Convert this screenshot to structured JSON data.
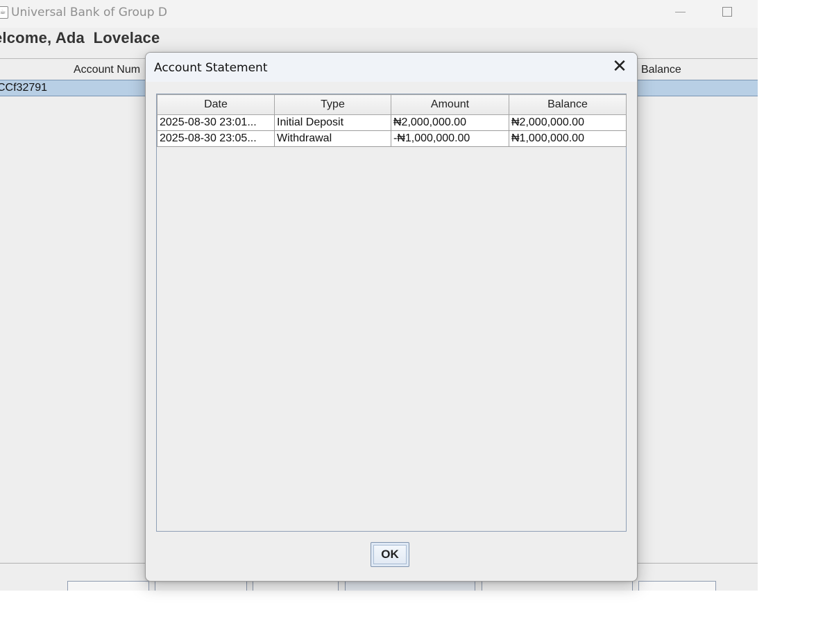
{
  "window": {
    "title": "Universal Bank of Group D",
    "app_icon_glyph": "☕",
    "welcome": "elcome, Ada  Lovelace",
    "columns": {
      "account_number": "Account Num",
      "balance": "Balance"
    },
    "selected_row": {
      "account_number": "CCf32791"
    }
  },
  "dialog": {
    "title": "Account Statement",
    "close_glyph": "✕",
    "table": {
      "headers": [
        "Date",
        "Type",
        "Amount",
        "Balance"
      ],
      "rows": [
        [
          "2025-08-30 23:01...",
          "Initial Deposit",
          "₦2,000,000.00",
          "₦2,000,000.00"
        ],
        [
          "2025-08-30 23:05...",
          "Withdrawal",
          "-₦1,000,000.00",
          "₦1,000,000.00"
        ]
      ]
    },
    "ok_label": "OK"
  },
  "icons": {
    "app": "java-cup-icon",
    "minimize": "minimize-icon",
    "maximize": "maximize-icon",
    "close": "close-icon"
  },
  "colors": {
    "selection": "#b8cfe5",
    "window_bg": "#eeeeee",
    "ok_button": "#dfe9f5"
  }
}
